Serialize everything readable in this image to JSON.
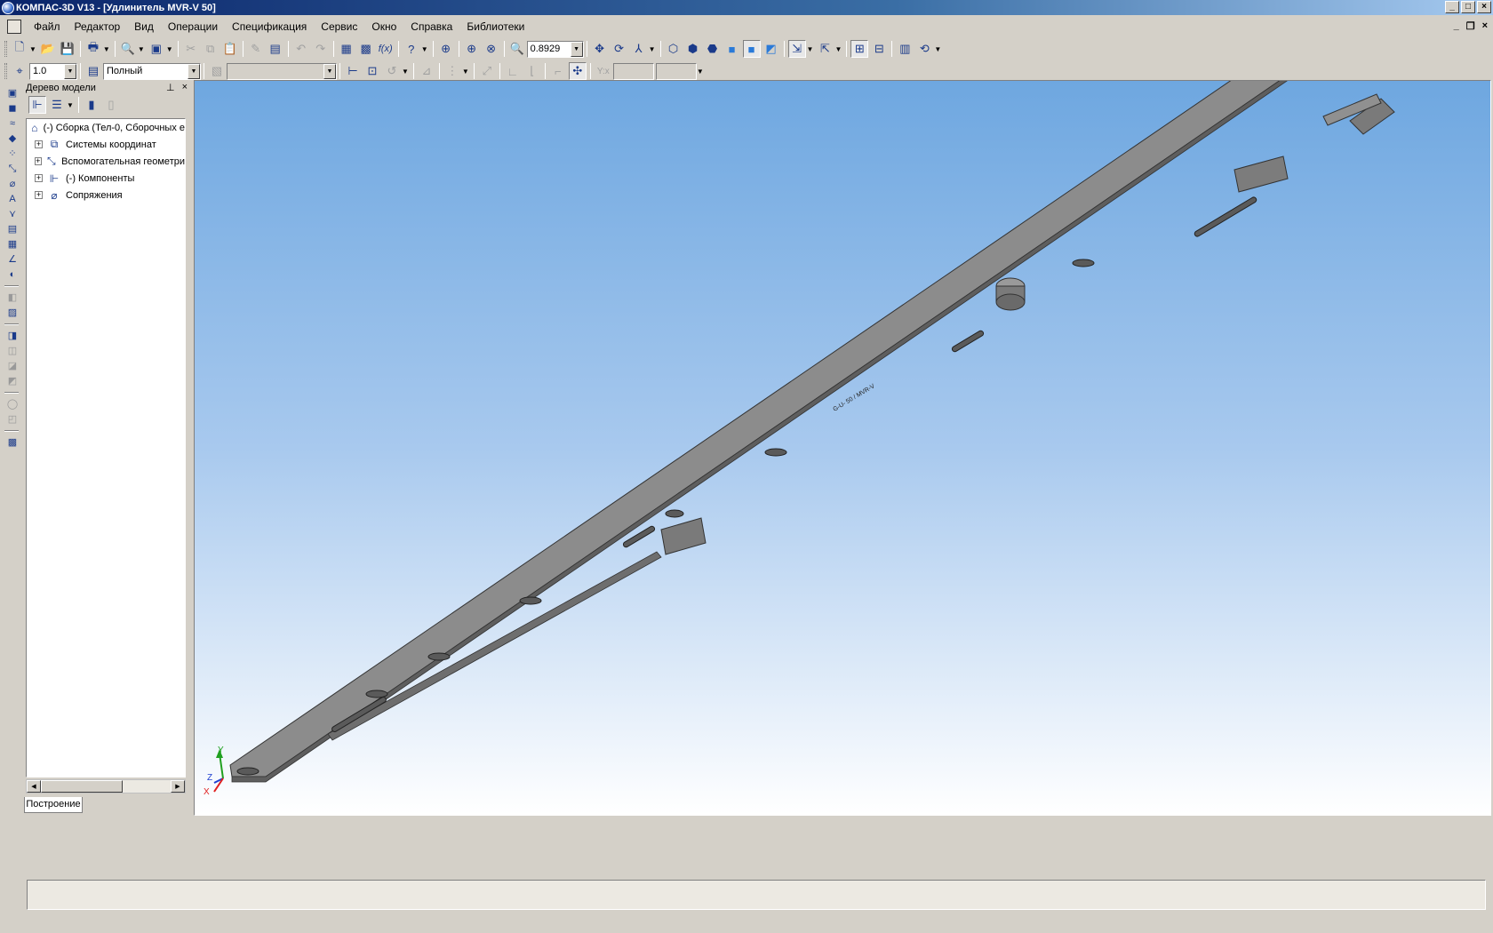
{
  "window": {
    "title": "КОМПАС-3D V13 - [Удлинитель MVR-V 50]"
  },
  "menu": {
    "items": [
      "Файл",
      "Редактор",
      "Вид",
      "Операции",
      "Спецификация",
      "Сервис",
      "Окно",
      "Справка",
      "Библиотеки"
    ]
  },
  "toolbar": {
    "zoom_value": "0.8929",
    "step_value": "1.0",
    "display_mode": "Полный"
  },
  "tree_panel": {
    "title": "Дерево модели",
    "nodes": [
      {
        "label": "(-) Сборка (Тел-0, Сборочных е",
        "icon": "assembly-icon"
      },
      {
        "label": "Системы координат",
        "icon": "coordinate-systems-icon"
      },
      {
        "label": "Вспомогательная геометри",
        "icon": "auxiliary-geometry-icon"
      },
      {
        "label": "(-) Компоненты",
        "icon": "components-icon"
      },
      {
        "label": "Сопряжения",
        "icon": "mates-icon"
      }
    ],
    "tab_label": "Построение"
  },
  "viewport": {
    "part_engraving": "G-U- 50 / MVR-V",
    "axis_labels": {
      "y": "Y",
      "z": "Z",
      "x": "X"
    },
    "colors": {
      "x_axis": "#e02020",
      "y_axis": "#20a020",
      "z_axis": "#2040d0",
      "part": "#8a8a8a"
    }
  }
}
